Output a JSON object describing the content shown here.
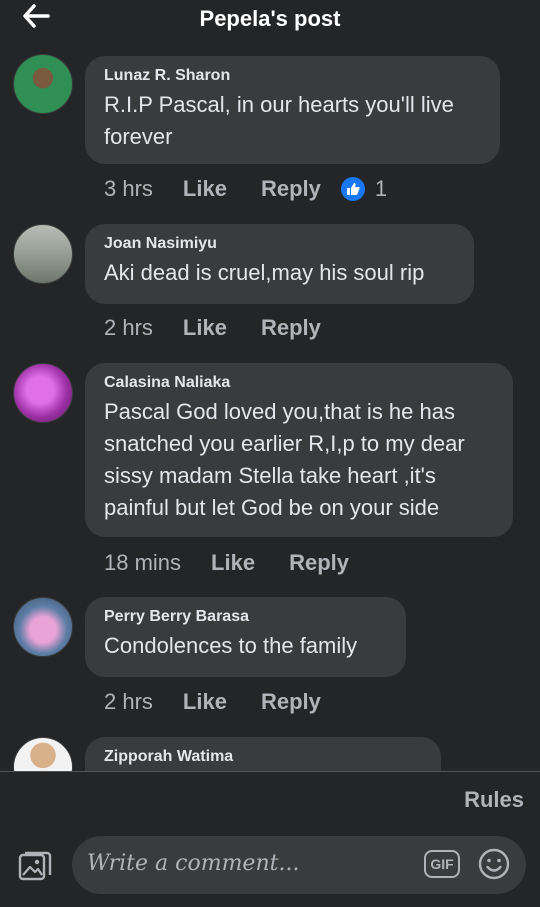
{
  "header": {
    "title": "Pepela's post"
  },
  "comments": [
    {
      "author": "Lunaz R. Sharon",
      "line1": "R.I.P Pascal, in our hearts you'll live",
      "line2": "forever",
      "time": "3 hrs",
      "like_label": "Like",
      "reply_label": "Reply",
      "reaction_count": "1",
      "reaction_icon": "thumbs-up-icon",
      "avatar_color": "#3fa96a"
    },
    {
      "author": "Joan Nasimiyu",
      "line1": "Aki dead is cruel,may his soul rip",
      "time": "2 hrs",
      "like_label": "Like",
      "reply_label": "Reply",
      "avatar_color": "#8a8f86"
    },
    {
      "author": "Calasina Naliaka",
      "line1": "Pascal God loved you,that is he has",
      "line2": "snatched you earlier R,I,p to my dear",
      "line3": "sissy madam Stella take heart ,it's",
      "line4": "painful but let God be on your side",
      "time": "18 mins",
      "like_label": "Like",
      "reply_label": "Reply",
      "avatar_color": "#b03ab5"
    },
    {
      "author": "Perry Berry Barasa",
      "line1": "Condolences to the family",
      "time": "2 hrs",
      "like_label": "Like",
      "reply_label": "Reply",
      "avatar_color": "#d98ac4"
    },
    {
      "author": "Zipporah Watima",
      "avatar_color": "#c9a17a"
    }
  ],
  "footer": {
    "rules_label": "Rules",
    "composer_placeholder": "Write a comment...",
    "gif_label": "GIF"
  },
  "colors": {
    "background": "#242526",
    "bubble": "#3a3b3c",
    "accent": "#1877f2"
  }
}
